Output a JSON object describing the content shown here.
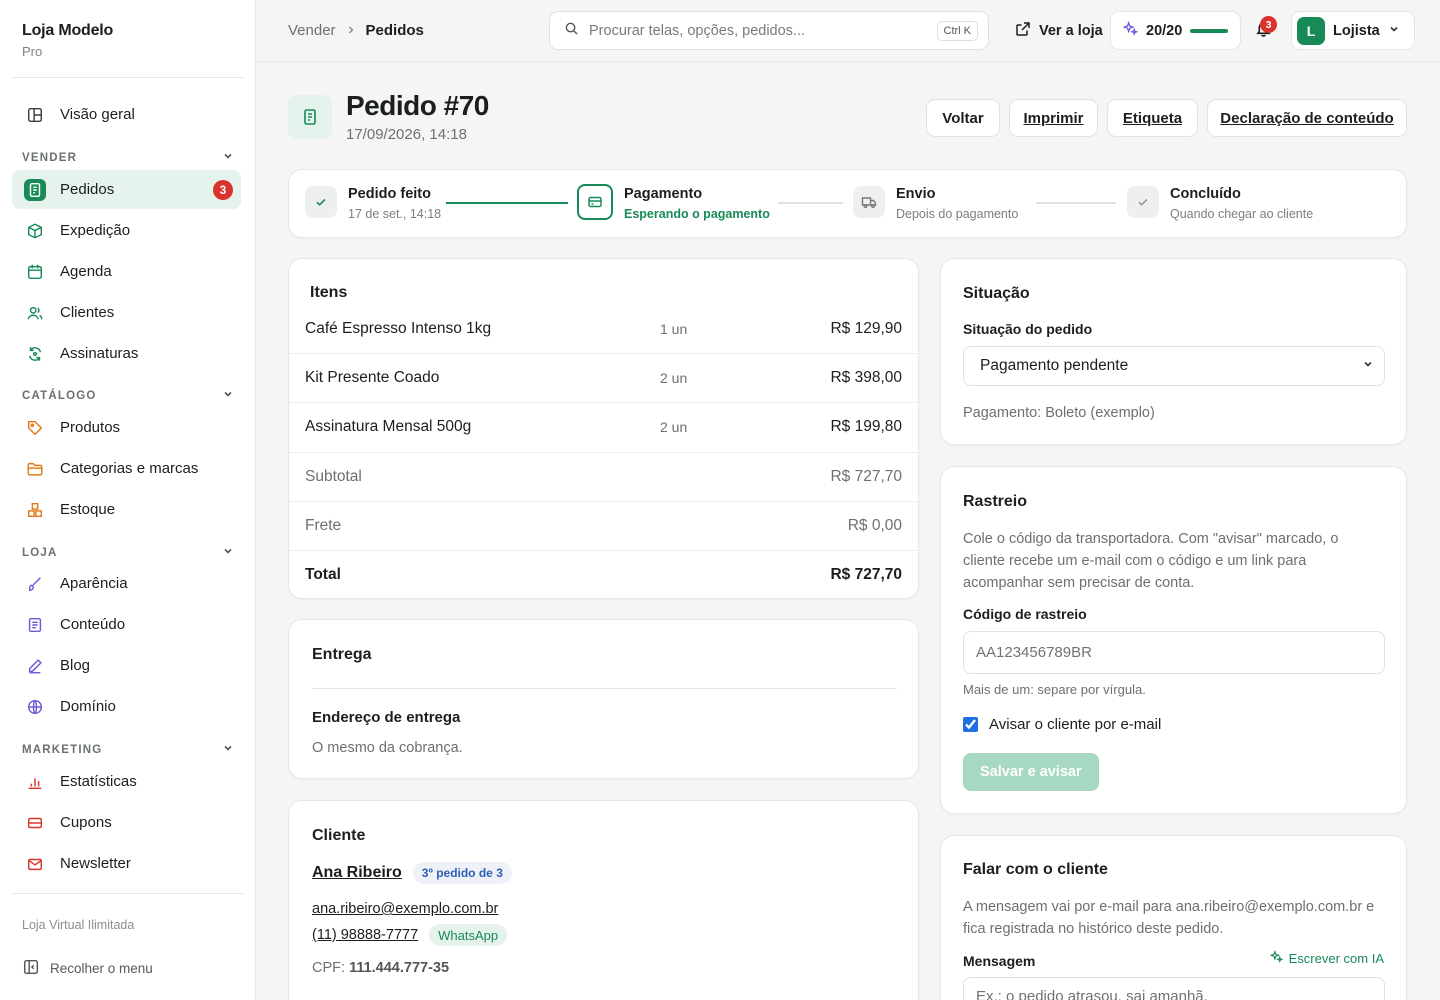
{
  "sidebar": {
    "brand": {
      "name": "Loja Modelo",
      "plan": "Pro"
    },
    "overview": "Visão geral",
    "sections": [
      {
        "title": "VENDER",
        "items": [
          {
            "label": "Pedidos",
            "badge": "3"
          },
          {
            "label": "Expedição"
          },
          {
            "label": "Agenda"
          },
          {
            "label": "Clientes"
          },
          {
            "label": "Assinaturas"
          }
        ]
      },
      {
        "title": "CATÁLOGO",
        "items": [
          {
            "label": "Produtos"
          },
          {
            "label": "Categorias e marcas"
          },
          {
            "label": "Estoque"
          }
        ]
      },
      {
        "title": "LOJA",
        "items": [
          {
            "label": "Aparência"
          },
          {
            "label": "Conteúdo"
          },
          {
            "label": "Blog"
          },
          {
            "label": "Domínio"
          }
        ]
      },
      {
        "title": "MARKETING",
        "items": [
          {
            "label": "Estatísticas"
          },
          {
            "label": "Cupons"
          },
          {
            "label": "Newsletter"
          }
        ]
      }
    ],
    "footer_plan": "Loja Virtual Ilimitada",
    "collapse_label": "Recolher o menu"
  },
  "topbar": {
    "breadcrumb": [
      "Vender",
      "Pedidos"
    ],
    "search_placeholder": "Procurar telas, opções, pedidos...",
    "search_shortcut": "Ctrl K",
    "view_store": "Ver a loja",
    "ai_credits": "20/20",
    "ai_credits_fraction": 1.0,
    "notifications": "3",
    "user_initial": "L",
    "user_name": "Lojista"
  },
  "page": {
    "title": "Pedido #70",
    "date": "17/09/2026, 14:18",
    "actions": [
      "Voltar",
      "Imprimir",
      "Etiqueta",
      "Declaração de conteúdo"
    ]
  },
  "progress": [
    {
      "title": "Pedido feito",
      "sub": "17 de set., 14:18",
      "state": "done"
    },
    {
      "title": "Pagamento",
      "sub": "Esperando o pagamento",
      "state": "current"
    },
    {
      "title": "Envio",
      "sub": "Depois do pagamento",
      "state": "pending"
    },
    {
      "title": "Concluído",
      "sub": "Quando chegar ao cliente",
      "state": "pending"
    }
  ],
  "items": {
    "title": "Itens",
    "rows": [
      {
        "name": "Café Espresso Intenso 1kg",
        "qty": "1 un",
        "price": "R$ 129,90"
      },
      {
        "name": "Kit Presente Coado",
        "qty": "2 un",
        "price": "R$ 398,00"
      },
      {
        "name": "Assinatura Mensal 500g",
        "qty": "2 un",
        "price": "R$ 199,80"
      }
    ],
    "subtotal_label": "Subtotal",
    "subtotal": "R$ 727,70",
    "shipping_label": "Frete",
    "shipping": "R$ 0,00",
    "total_label": "Total",
    "total": "R$ 727,70"
  },
  "delivery": {
    "title": "Entrega",
    "address_label": "Endereço de entrega",
    "address_value": "O mesmo da cobrança."
  },
  "customer": {
    "title": "Cliente",
    "name": "Ana Ribeiro",
    "order_badge": "3º pedido de 3",
    "email": "ana.ribeiro@exemplo.com.br",
    "phone": "(11) 98888-7777",
    "whatsapp": "WhatsApp",
    "cpf_label": "CPF:",
    "cpf": "111.444.777-35"
  },
  "status": {
    "title": "Situação",
    "field_label": "Situação do pedido",
    "selected": "Pagamento pendente",
    "payment_note": "Pagamento: Boleto (exemplo)"
  },
  "tracking": {
    "title": "Rastreio",
    "description": "Cole o código da transportadora. Com \"avisar\" marcado, o cliente recebe um e-mail com o código e um link para acompanhar sem precisar de conta.",
    "code_label": "Código de rastreio",
    "code_placeholder": "AA123456789BR",
    "hint": "Mais de um: separe por vírgula.",
    "notify_label": "Avisar o cliente por e-mail",
    "notify_checked": true,
    "save_label": "Salvar e avisar"
  },
  "message": {
    "title": "Falar com o cliente",
    "description": "A mensagem vai por e-mail para ana.ribeiro@exemplo.com.br e fica registrada no histórico deste pedido.",
    "field_label": "Mensagem",
    "ai_label": "Escrever com IA",
    "placeholder": "Ex.: o pedido atrasou, sai amanhã."
  },
  "colors": {
    "accent": "#178a57",
    "accent_light": "#e6f2ec",
    "danger": "#d9332b"
  }
}
